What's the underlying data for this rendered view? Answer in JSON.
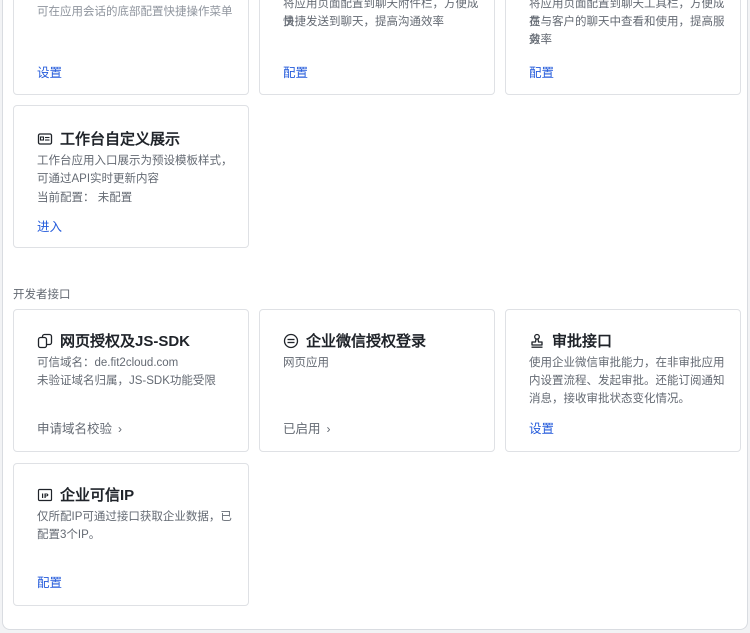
{
  "top_cards": [
    {
      "desc": "可在应用会话的底部配置快捷操作菜单",
      "action": "设置"
    },
    {
      "desc_line1": "将应用页面配置到聊天附件栏，方便成员",
      "desc_line2": "快捷发送到聊天，提高沟通效率",
      "action": "配置"
    },
    {
      "desc_line1": "将应用页面配置到聊天工具栏，方便成员",
      "desc_line2": "在与客户的聊天中查看和使用，提高服务",
      "desc_line3": "效率",
      "action": "配置"
    }
  ],
  "workbench_card": {
    "icon": "display-card-icon",
    "title": "工作台自定义展示",
    "desc": "工作台应用入口展示为预设模板样式，可通过API实时更新内容",
    "current_config": "当前配置： 未配置",
    "action": "进入"
  },
  "section": {
    "label": "开发者接口"
  },
  "dev_cards": [
    {
      "icon": "link-copy-icon",
      "title": "网页授权及JS-SDK",
      "desc_line1": "可信域名：de.fit2cloud.com",
      "desc_line2": "未验证域名归属，JS-SDK功能受限",
      "action": "申请域名校验"
    },
    {
      "icon": "oauth-login-icon",
      "title": "企业微信授权登录",
      "desc": "网页应用",
      "action": "已启用"
    },
    {
      "icon": "stamp-icon",
      "title": "审批接口",
      "desc": "使用企业微信审批能力，在非审批应用内设置流程、发起审批。还能订阅通知消息，接收审批状态变化情况。",
      "action": "设置"
    },
    {
      "icon": "ip-icon",
      "title": "企业可信IP",
      "desc": "仅所配IP可通过接口获取企业数据，已配置3个IP。",
      "action": "配置"
    }
  ]
}
